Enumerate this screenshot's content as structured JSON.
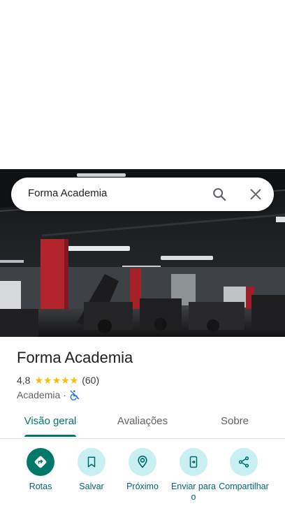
{
  "search": {
    "query": "Forma Academia"
  },
  "place": {
    "name": "Forma Academia",
    "rating": "4,8",
    "stars": "★★★★★",
    "review_count": "(60)",
    "category": "Academia",
    "separator": "·"
  },
  "tabs": [
    {
      "label": "Visão geral",
      "active": true
    },
    {
      "label": "Avaliações",
      "active": false
    },
    {
      "label": "Sobre",
      "active": false
    }
  ],
  "actions": [
    {
      "label": "Rotas",
      "icon": "directions-icon"
    },
    {
      "label": "Salvar",
      "icon": "bookmark-icon"
    },
    {
      "label": "Próximo",
      "icon": "nearby-icon"
    },
    {
      "label": "Enviar para o",
      "icon": "send-to-phone-icon"
    },
    {
      "label": "Compartilhar",
      "icon": "share-icon"
    }
  ],
  "colors": {
    "accent": "#00796b",
    "action_bg": "#c8f0f3",
    "star": "#fbbc04"
  }
}
